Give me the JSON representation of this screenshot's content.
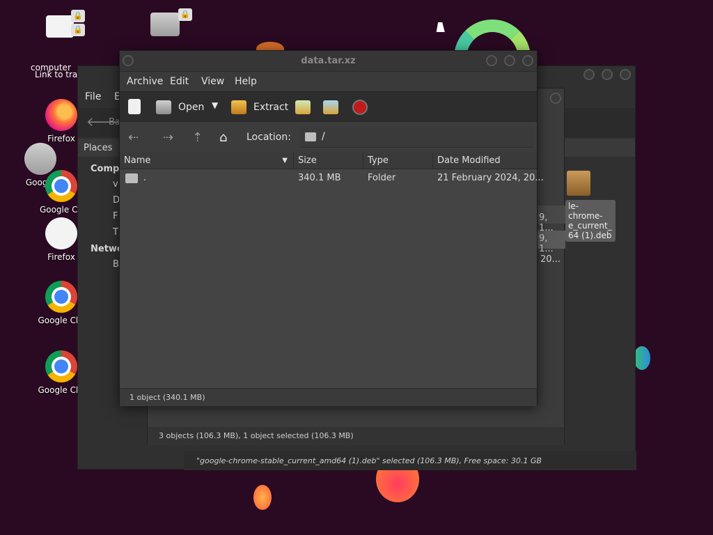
{
  "main_window": {
    "title": "data.tar.xz",
    "menu": [
      "Archive",
      "Edit",
      "View",
      "Help"
    ],
    "toolbar": {
      "open_label": "Open",
      "extract_label": "Extract"
    },
    "location_label": "Location:",
    "location_path": "/",
    "columns": [
      "Name",
      "Size",
      "Type",
      "Date Modified"
    ],
    "rows": [
      {
        "name": ".",
        "size": "340.1 MB",
        "type": "Folder",
        "date": "21 February 2024, 20..."
      }
    ],
    "status": "1 object (340.1 MB)"
  },
  "back_window_1": {
    "status": "3 objects (106.3 MB), 1 object selected (106.3 MB)",
    "partial_dates": [
      "9, 1...",
      "9, 1...",
      "20..."
    ]
  },
  "back_window_2": {
    "menu_file": "File",
    "menu_e": "E",
    "back_label": "Ba",
    "places_label": "Places",
    "computer_label": "Compu",
    "network_label": "Netwo",
    "sidebar_letters": [
      "vi",
      "D",
      "F",
      "T",
      "B"
    ],
    "status": "\"google-chrome-stable_current_amd64 (1).deb\" selected (106.3 MB), Free space: 30.1 GB",
    "selected_file_label": "le-chrome-\ne_current_\n64 (1).deb"
  },
  "desktop": {
    "icons": [
      {
        "label": "Firefox"
      },
      {
        "label": "Google"
      },
      {
        "label": "Google Ch"
      },
      {
        "label": "Firefox"
      },
      {
        "label": "Google Chr"
      },
      {
        "label": "Google Chr"
      }
    ],
    "top_left_labels": "Link to tra",
    "computer_label": "computer"
  }
}
